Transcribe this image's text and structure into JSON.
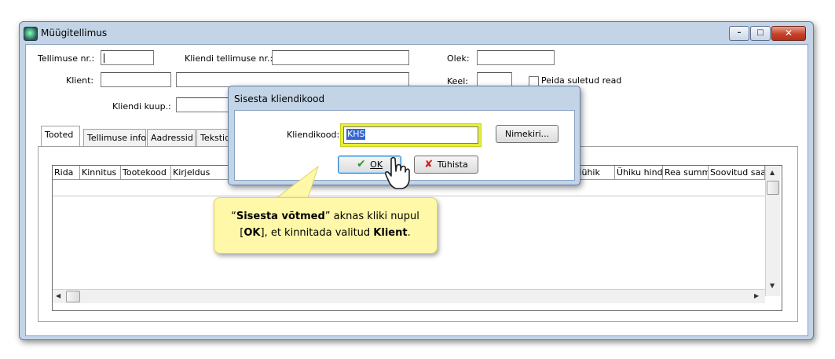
{
  "window": {
    "title": "Müügitellimus",
    "controls": {
      "minimize": "–",
      "maximize": "□",
      "close": "✕"
    }
  },
  "form": {
    "order_no_label": "Tellimuse nr.:",
    "order_no_value": "",
    "client_order_label": "Kliendi tellimuse nr.:",
    "client_order_value": "",
    "status_label": "Olek:",
    "status_value": "",
    "client_label": "Klient:",
    "client_code_value": "",
    "client_name_value": "",
    "language_label": "Keel:",
    "language_value": "",
    "hide_closed_label": "Peida suletud read",
    "hide_closed_checked": false,
    "client_purchase_label": "Kliendi kuup.:",
    "client_purchase_value": ""
  },
  "tabs": [
    "Tooted",
    "Tellimuse info",
    "Aadressid",
    "Tekstid"
  ],
  "grid": {
    "columns": [
      "Rida",
      "Kinnitus",
      "Tootekood",
      "Kirjeldus",
      "Müügiühik",
      "Ühiku hind",
      "Rea summ",
      "Soovitud saa"
    ],
    "rows": []
  },
  "dialog": {
    "title": "Sisesta kliendikood",
    "field_label": "Kliendikood:",
    "field_value": "KHS",
    "list_button": "Nimekiri...",
    "ok_button": "OK",
    "cancel_button": "Tühista"
  },
  "callout": {
    "q_open": "“",
    "bold1": "Sisesta võtmed",
    "t1": "” aknas kliki nupul",
    "t2": "[",
    "bold2": "OK",
    "t3": "], et kinnitada valitud ",
    "bold3": "Klient",
    "t4": "."
  },
  "colors": {
    "accent": "#3367d6",
    "highlight": "#e6ef3a",
    "callout": "#fff8a8",
    "window_frame": "#c3d4e7"
  }
}
